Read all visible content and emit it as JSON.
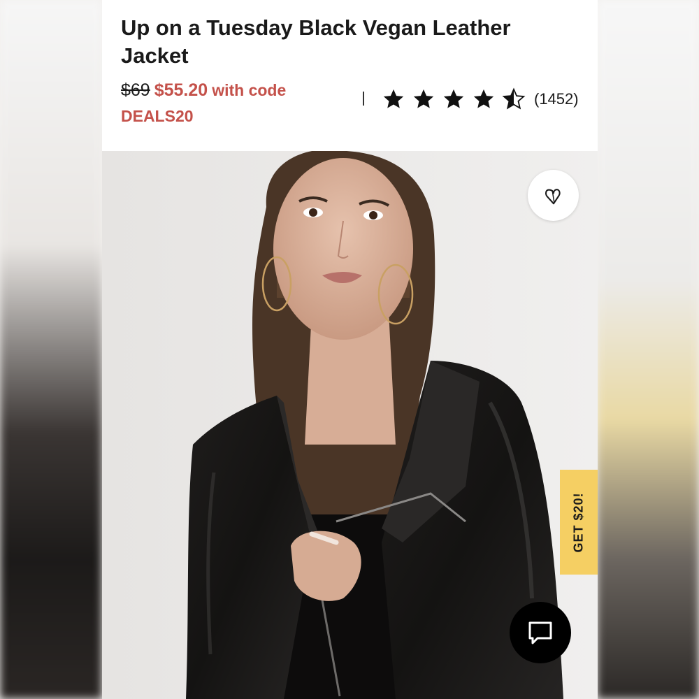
{
  "product": {
    "title": "Up on a Tuesday Black Vegan Leather Jacket",
    "original_price": "$69",
    "sale_price": "$55.20",
    "with_code_text": "with code",
    "promo_code": "DEALS20",
    "rating": 4.5,
    "rating_max": 5,
    "review_count": "(1452)"
  },
  "promo_tab": {
    "label": "GET $20!"
  },
  "icons": {
    "wishlist": "heart-outline-icon",
    "chat": "chat-bubble-icon",
    "star": "star-icon"
  },
  "colors": {
    "sale_accent": "#c4514a",
    "promo_tab": "#f5cf63",
    "chat_button": "#000000"
  }
}
